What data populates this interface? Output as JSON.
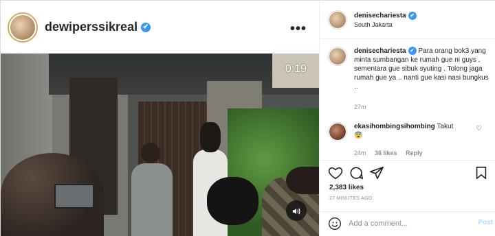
{
  "left_header": {
    "username": "dewiperssikreal",
    "verified_mark": "✔",
    "more_label": "•••"
  },
  "video": {
    "timecode": "0:19",
    "audio_icon": "speaker-icon"
  },
  "post_header": {
    "username": "denisechariesta",
    "verified_mark": "✔",
    "location": "South Jakarta"
  },
  "caption": {
    "username": "denisechariesta",
    "text": "Para orang bok3 yang minta sumbangan ke rumah gue ni guys , sementara gue sibuk syuting . Tolong jaga rumah gue ya .. nanti gue kasi nasi bungkus ..",
    "time": "27m"
  },
  "comment": {
    "username": "ekasihombingsihombing",
    "text": "Takut",
    "emoji": "😨",
    "time": "24m",
    "likes": "36 likes",
    "reply": "Reply"
  },
  "actions": {
    "likes": "2,383 likes",
    "timestamp": "27 MINUTES AGO"
  },
  "add_comment": {
    "placeholder": "Add a comment...",
    "post_label": "Post"
  },
  "colors": {
    "verified": "#3897f0",
    "post_button": "#b3dbff",
    "muted_text": "#8e8e8e"
  }
}
